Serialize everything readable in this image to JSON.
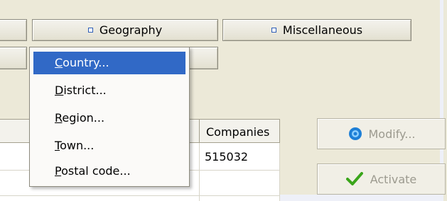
{
  "tabs": [
    {
      "label": "Geography"
    },
    {
      "label": "Miscellaneous"
    }
  ],
  "geography_menu": {
    "items": [
      {
        "accel": "C",
        "rest": "ountry...",
        "selected": true
      },
      {
        "accel": "D",
        "rest": "istrict...",
        "selected": false
      },
      {
        "accel": "R",
        "rest": "egion...",
        "selected": false
      },
      {
        "accel": "T",
        "rest": "own...",
        "selected": false
      },
      {
        "accel": "P",
        "rest": "ostal code...",
        "selected": false
      }
    ]
  },
  "grid": {
    "columns": [
      "Companies"
    ],
    "rows": [
      {
        "companies": "515032"
      }
    ]
  },
  "actions": {
    "modify_label": "Modify...",
    "activate_label": "Activate",
    "modify_enabled": false,
    "activate_enabled": false
  },
  "colors": {
    "menu_highlight": "#3169c6",
    "window_bg": "#ece9d8",
    "activate_check": "#3aa51a",
    "modify_icon": "#1e7fd6"
  }
}
